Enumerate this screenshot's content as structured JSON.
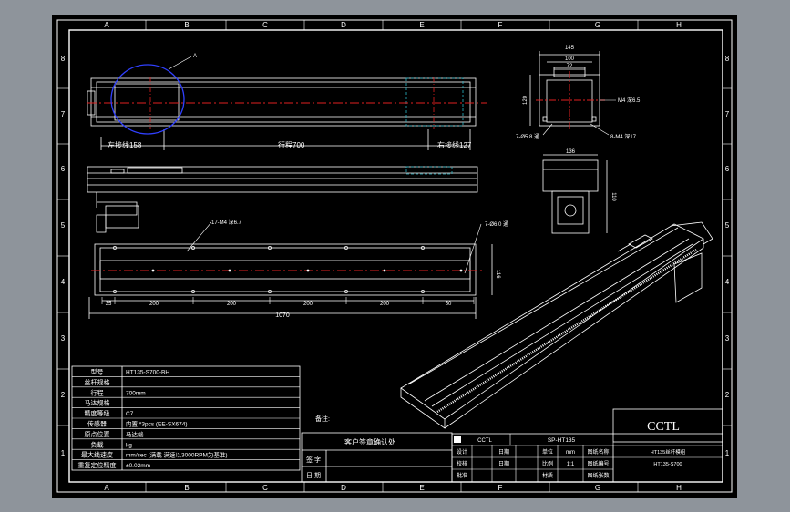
{
  "colors": {
    "background": "#8e949b",
    "sheet": "#000000",
    "line": "#ffffff",
    "centerline": "#e02020",
    "cyan": "#2ab7c8",
    "circle": "#3040ff"
  },
  "grid": {
    "cols": [
      "A",
      "B",
      "C",
      "D",
      "E",
      "F",
      "G",
      "H"
    ],
    "rows": [
      "8",
      "7",
      "6",
      "5",
      "4",
      "3",
      "2",
      "1"
    ]
  },
  "top_view": {
    "detail_mark": "A",
    "left_dim": "左接线158",
    "travel_dim": "行程700",
    "right_dim": "右接线127"
  },
  "bottom_view": {
    "hole_note_left": "17-M4 深6.7",
    "hole_note_right": "7-Ø6.0 通",
    "height_dim": "116",
    "pitch_labels": [
      "35",
      "200",
      "200",
      "200",
      "200",
      "50"
    ],
    "total_dim": "1070"
  },
  "end_view": {
    "width_dim": "145",
    "inner_dim_1": "100",
    "inner_dim_2": "72",
    "height_dim": "120",
    "note_right": "M4 深6.5",
    "note_bl": "7-Ø5.8 通",
    "note_br": "8-M4 深17"
  },
  "side_end_view": {
    "width_dim": "136",
    "height_dim": "110"
  },
  "param_table": {
    "rows": [
      {
        "label": "型号",
        "value": "HT135-S700-BH"
      },
      {
        "label": "丝杆规格",
        "value": ""
      },
      {
        "label": "行程",
        "value": "700mm"
      },
      {
        "label": "马达规格",
        "value": ""
      },
      {
        "label": "精度等级",
        "value": "C7"
      },
      {
        "label": "传感器",
        "value": "内置 *3pcs (EE-SX674)"
      },
      {
        "label": "原点位置",
        "value": "马达端"
      },
      {
        "label": "负载",
        "value": "kg"
      },
      {
        "label": "最大线速度",
        "value": "mm/sec (满载 满速以3000RPM为基准)"
      },
      {
        "label": "重复定位精度",
        "value": "±0.02mm"
      }
    ]
  },
  "remark_label": "备注:",
  "customer_confirm": "客户签章确认处",
  "sign_label": "签 字",
  "date_label": "日 期",
  "title_block": {
    "company": "CCTL",
    "left_logo": "CCTL",
    "drawing_no": "SP-HT135",
    "product_name": "HT135丝杆模组",
    "drawing_code": "HT135-S700",
    "rows": [
      [
        "设计",
        "",
        "日期",
        "",
        "单位",
        "mm",
        "图纸名称",
        ""
      ],
      [
        "校核",
        "",
        "日期",
        "",
        "比例",
        "1:1",
        "图纸编号",
        ""
      ],
      [
        "批准",
        "",
        "",
        "",
        "材质",
        "",
        "图纸张数",
        ""
      ]
    ]
  }
}
